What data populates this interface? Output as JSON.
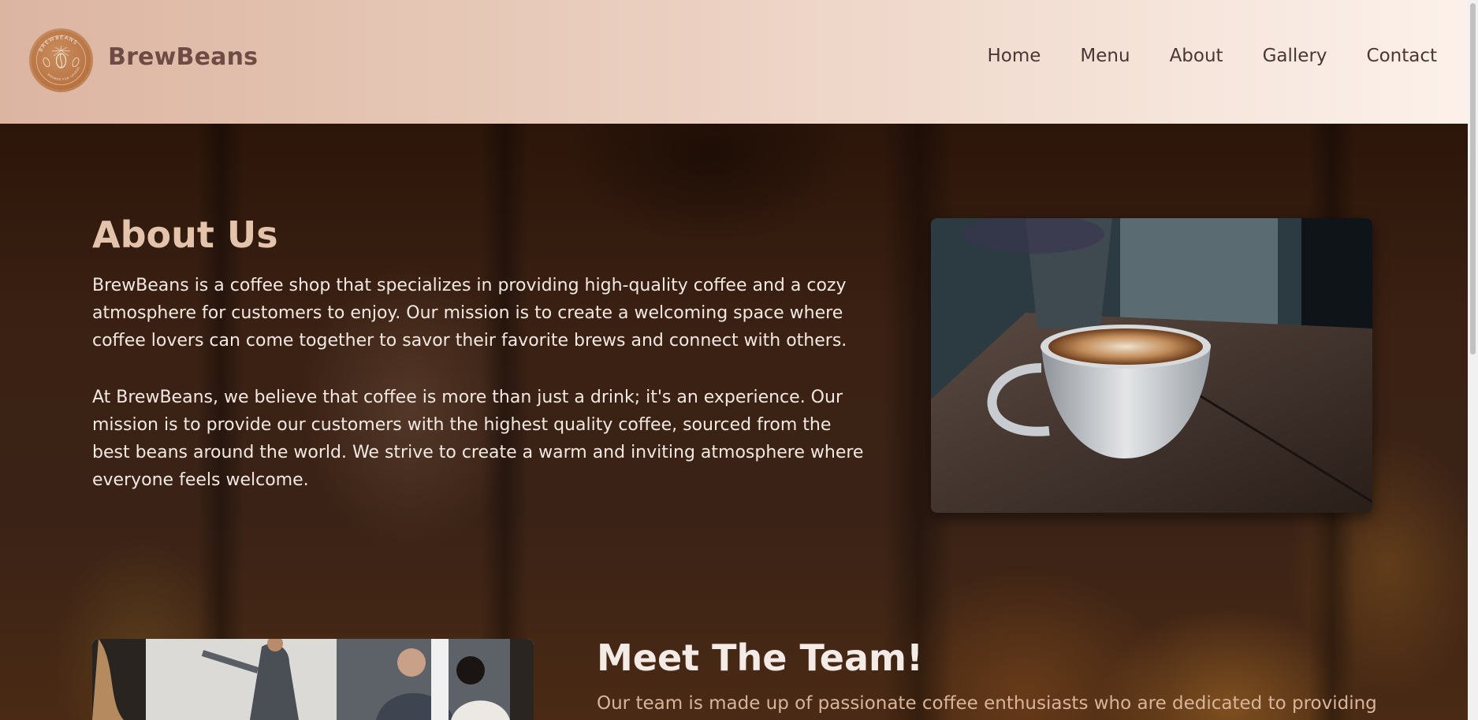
{
  "header": {
    "brand_name": "BrewBeans",
    "logo_text": "BREWBEANS",
    "logo_subtext": "BREWED FOR LOVERS",
    "nav": [
      {
        "label": "Home"
      },
      {
        "label": "Menu"
      },
      {
        "label": "About"
      },
      {
        "label": "Gallery"
      },
      {
        "label": "Contact"
      }
    ]
  },
  "about": {
    "title": "About Us",
    "paragraph1": "BrewBeans is a coffee shop that specializes in providing high-quality coffee and a cozy atmosphere for customers to enjoy. Our mission is to create a welcoming space where coffee lovers can come together to savor their favorite brews and connect with others.",
    "paragraph2": "At BrewBeans, we believe that coffee is more than just a drink; it's an experience. Our mission is to provide our customers with the highest quality coffee, sourced from the best beans around the world. We strive to create a warm and inviting atmosphere where everyone feels welcome.",
    "image_icon": "coffee-cup-photo"
  },
  "team": {
    "title": "Meet The Team!",
    "text": "Our team is made up of passionate coffee enthusiasts who are dedicated to providing",
    "image_icon": "team-meeting-photo"
  },
  "colors": {
    "header_start": "#dcb5a1",
    "header_end": "#fcf1ea",
    "accent": "#e3c3ab",
    "logo": "#b7713f",
    "brand_text": "#6e4b44"
  }
}
